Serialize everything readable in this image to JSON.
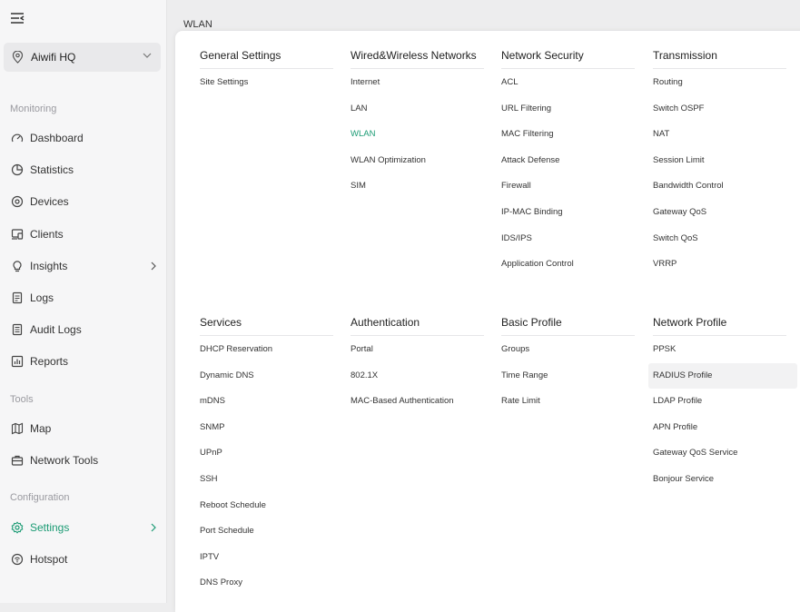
{
  "site": {
    "name": "Aiwifi HQ"
  },
  "page": {
    "title": "WLAN"
  },
  "sidebar": {
    "sections": {
      "monitoring": "Monitoring",
      "tools": "Tools",
      "configuration": "Configuration"
    },
    "items": [
      {
        "label": "Dashboard",
        "icon": "gauge-icon"
      },
      {
        "label": "Statistics",
        "icon": "pie-chart-icon"
      },
      {
        "label": "Devices",
        "icon": "device-icon"
      },
      {
        "label": "Clients",
        "icon": "clients-icon"
      },
      {
        "label": "Insights",
        "icon": "lightbulb-icon"
      },
      {
        "label": "Logs",
        "icon": "log-icon"
      },
      {
        "label": "Audit Logs",
        "icon": "audit-log-icon"
      },
      {
        "label": "Reports",
        "icon": "report-icon"
      },
      {
        "label": "Map",
        "icon": "map-icon"
      },
      {
        "label": "Network Tools",
        "icon": "toolbox-icon"
      },
      {
        "label": "Settings",
        "icon": "gear-icon"
      },
      {
        "label": "Hotspot",
        "icon": "hotspot-icon"
      }
    ],
    "accent_color": "#1b9b74"
  },
  "menu": {
    "general": {
      "title": "General Settings",
      "items": [
        "Site Settings"
      ]
    },
    "wired": {
      "title": "Wired&Wireless Networks",
      "items": [
        "Internet",
        "LAN",
        "WLAN",
        "WLAN Optimization",
        "SIM"
      ]
    },
    "security": {
      "title": "Network Security",
      "items": [
        "ACL",
        "URL Filtering",
        "MAC Filtering",
        "Attack Defense",
        "Firewall",
        "IP-MAC Binding",
        "IDS/IPS",
        "Application Control"
      ]
    },
    "transmission": {
      "title": "Transmission",
      "items": [
        "Routing",
        "Switch OSPF",
        "NAT",
        "Session Limit",
        "Bandwidth Control",
        "Gateway QoS",
        "Switch QoS",
        "VRRP"
      ]
    },
    "services": {
      "title": "Services",
      "items": [
        "DHCP Reservation",
        "Dynamic DNS",
        "mDNS",
        "SNMP",
        "UPnP",
        "SSH",
        "Reboot Schedule",
        "Port Schedule",
        "IPTV",
        "DNS Proxy"
      ]
    },
    "authentication": {
      "title": "Authentication",
      "items": [
        "Portal",
        "802.1X",
        "MAC-Based Authentication"
      ]
    },
    "basic_profile": {
      "title": "Basic Profile",
      "items": [
        "Groups",
        "Time Range",
        "Rate Limit"
      ]
    },
    "network_profile": {
      "title": "Network Profile",
      "items": [
        "PPSK",
        "RADIUS Profile",
        "LDAP Profile",
        "APN Profile",
        "Gateway QoS Service",
        "Bonjour Service"
      ]
    }
  }
}
